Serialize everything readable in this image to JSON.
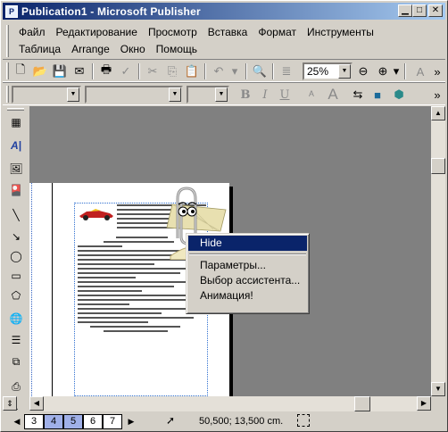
{
  "window": {
    "title": "Publication1 - Microsoft Publisher"
  },
  "menus": {
    "row1": [
      "Файл",
      "Редактирование",
      "Просмотр",
      "Вставка",
      "Формат",
      "Инструменты"
    ],
    "row2": [
      "Таблица",
      "Arrange",
      "Окно",
      "Помощь"
    ]
  },
  "toolbar": {
    "zoom": "25%"
  },
  "context_menu": {
    "items": [
      "Hide",
      "Параметры...",
      "Выбор ассистента...",
      "Анимация!"
    ],
    "highlighted": "Hide"
  },
  "status": {
    "pages": [
      "3",
      "4",
      "5",
      "6",
      "7"
    ],
    "selected_pages": [
      "4",
      "5"
    ],
    "coordinates": "50,500; 13,500 cm."
  }
}
